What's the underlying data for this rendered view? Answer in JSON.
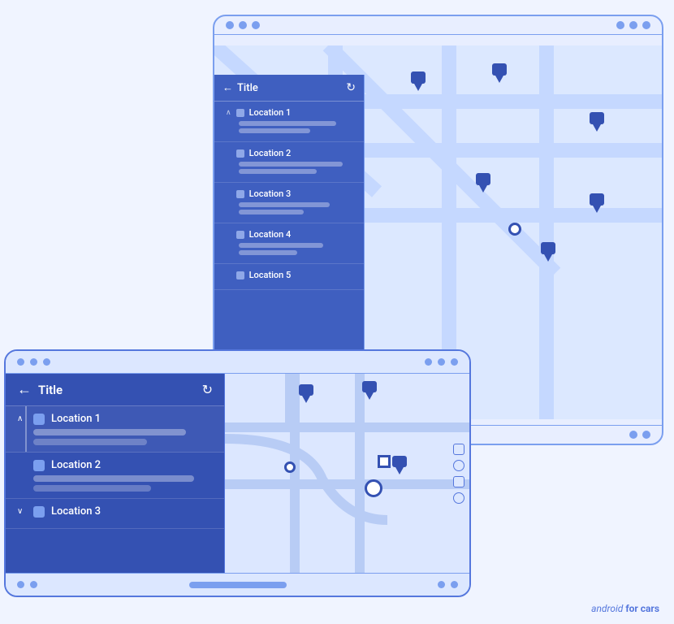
{
  "app": {
    "brand": "android",
    "brand_suffix": "for cars"
  },
  "back_device": {
    "title": "Title",
    "refresh_label": "↻",
    "back_label": "←",
    "locations": [
      {
        "id": 1,
        "name": "Location 1",
        "bar1_width": "75%",
        "bar2_width": "55%"
      },
      {
        "id": 2,
        "name": "Location 2",
        "bar1_width": "80%",
        "bar2_width": "60%"
      },
      {
        "id": 3,
        "name": "Location 3",
        "bar1_width": "70%",
        "bar2_width": "50%"
      },
      {
        "id": 4,
        "name": "Location 4",
        "bar1_width": "65%",
        "bar2_width": "45%"
      },
      {
        "id": 5,
        "name": "Location 5",
        "bar1_width": "72%",
        "bar2_width": "52%"
      }
    ]
  },
  "front_device": {
    "title": "Title",
    "refresh_label": "↻",
    "back_label": "←",
    "locations": [
      {
        "id": 1,
        "name": "Location 1",
        "expanded": true,
        "bar1_width": "75%",
        "bar2_width": "55%"
      },
      {
        "id": 2,
        "name": "Location 2",
        "expanded": false,
        "bar1_width": "80%",
        "bar2_width": "60%"
      },
      {
        "id": 3,
        "name": "Location 3",
        "expanded": false,
        "bar1_width": "70%",
        "bar2_width": "50%"
      }
    ]
  },
  "colors": {
    "panel_bg": "#3451b2",
    "panel_border": "#5577dd",
    "map_bg": "#dce7ff",
    "device_border": "#5577dd",
    "dot_color": "#7b9fef",
    "pin_color": "#3451b2",
    "bar_color": "rgba(255,255,255,0.35)"
  }
}
